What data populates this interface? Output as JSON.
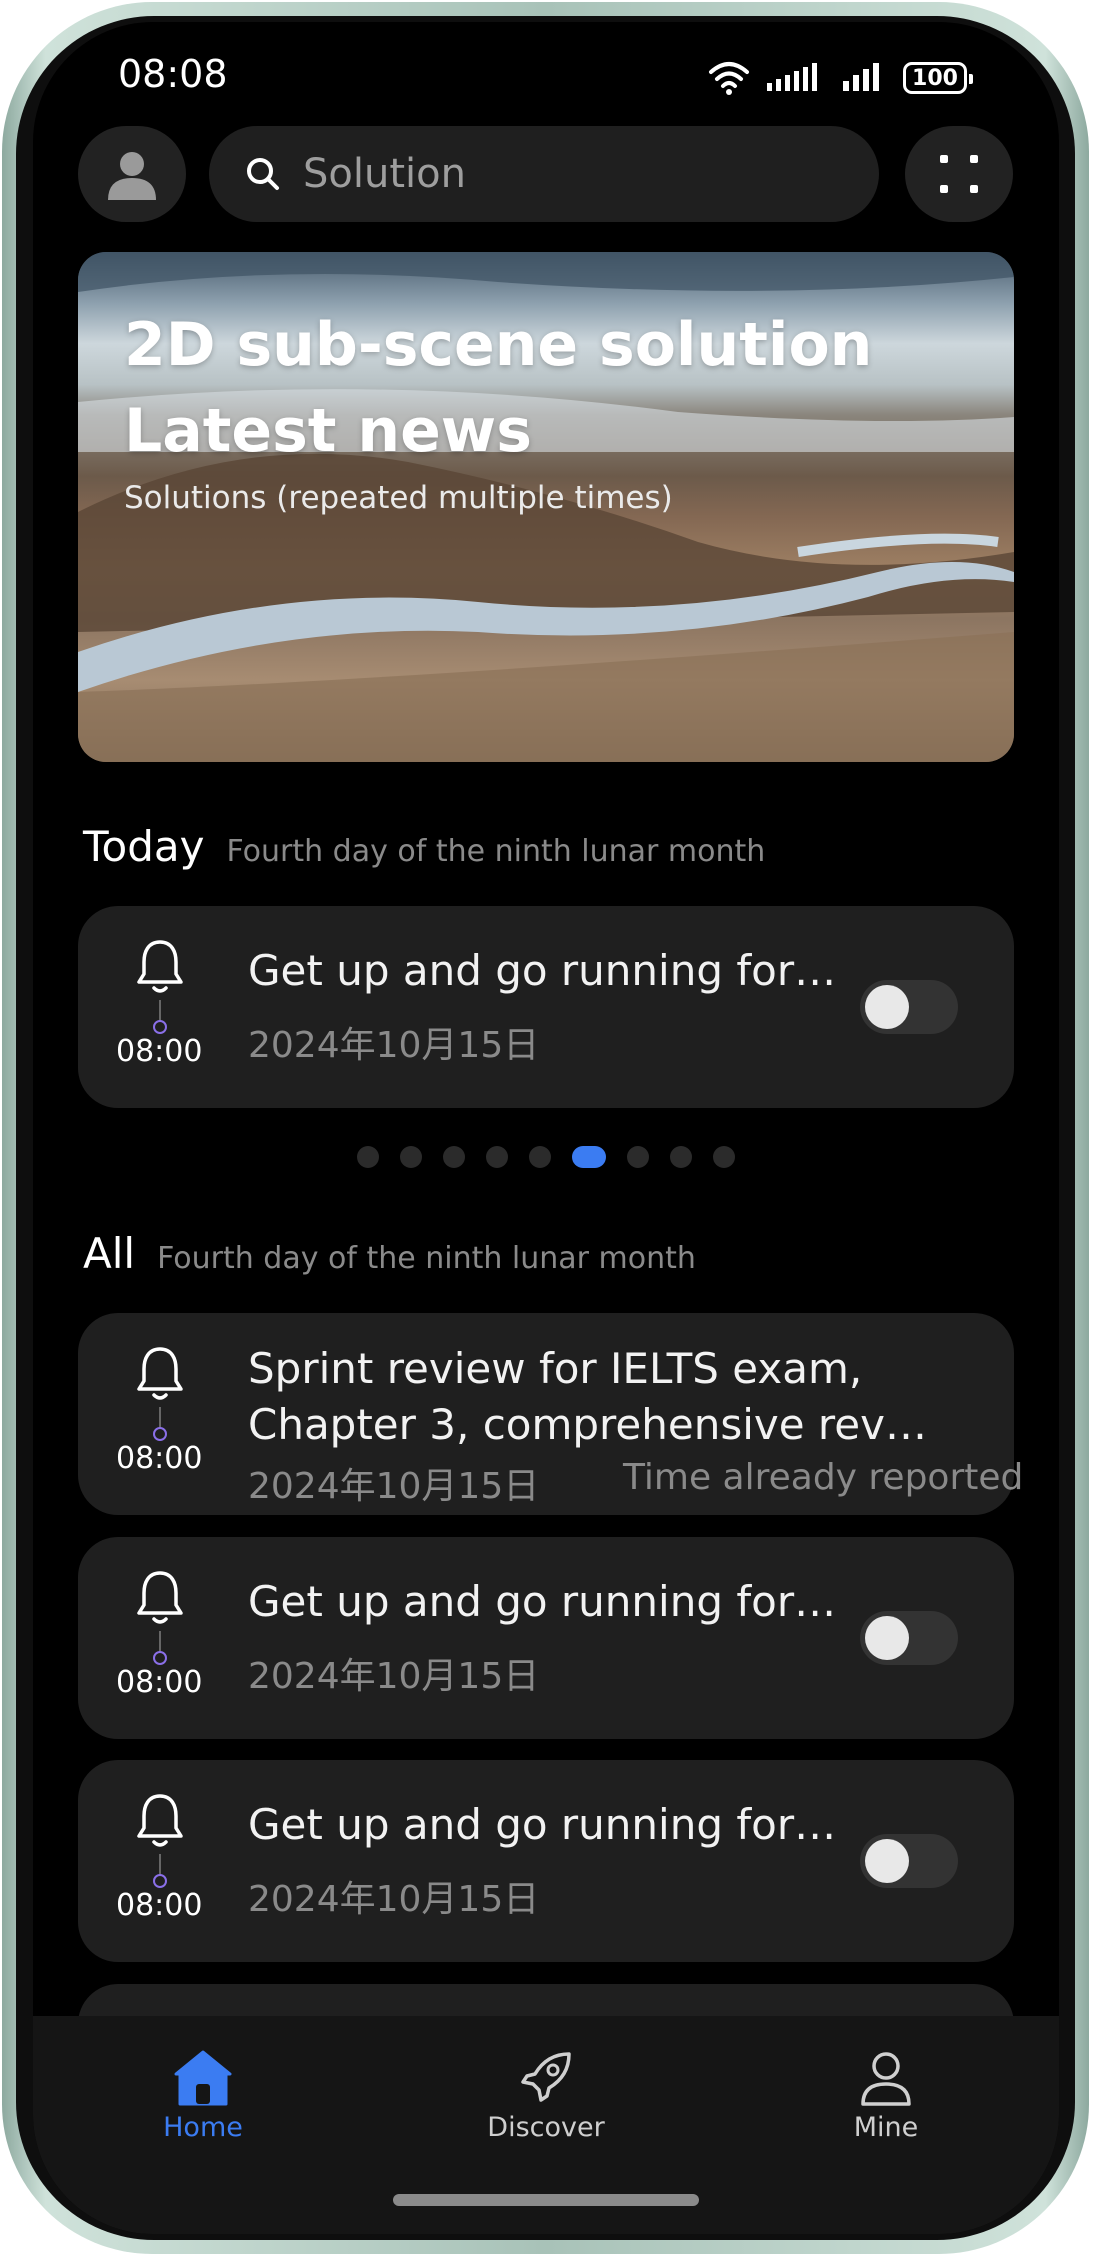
{
  "status_bar": {
    "time": "08:08",
    "battery": "100"
  },
  "search": {
    "placeholder": "Solution"
  },
  "banner": {
    "title_line1": "2D sub-scene solution",
    "title_line2": "Latest news",
    "subtitle": "Solutions (repeated multiple times)"
  },
  "today": {
    "title": "Today",
    "subtitle": "Fourth day of the ninth lunar month",
    "card": {
      "time": "08:00",
      "title": "Get up and go running for …",
      "date": "2024年10月15日",
      "enabled": false
    }
  },
  "pager": {
    "count": 9,
    "active_index": 5
  },
  "all": {
    "title": "All",
    "subtitle": "Fourth day of the ninth lunar month",
    "items": [
      {
        "time": "08:00",
        "title_line1": "Sprint review for IELTS exam,",
        "title_line2": "Chapter 3, comprehensive revie…",
        "date": "2024年10月15日",
        "note": "Time already reported"
      },
      {
        "time": "08:00",
        "title": "Get up and go running for …",
        "date": "2024年10月15日",
        "enabled": false
      },
      {
        "time": "08:00",
        "title": "Get up and go running for …",
        "date": "2024年10月15日",
        "enabled": false
      }
    ]
  },
  "tabs": [
    {
      "label": "Home",
      "icon": "home-icon",
      "active": true
    },
    {
      "label": "Discover",
      "icon": "rocket-icon",
      "active": false
    },
    {
      "label": "Mine",
      "icon": "person-icon",
      "active": false
    }
  ],
  "colors": {
    "accent": "#3b7cf2",
    "card_bg": "#1f1f1f",
    "muted_text": "#8a8a8a"
  }
}
